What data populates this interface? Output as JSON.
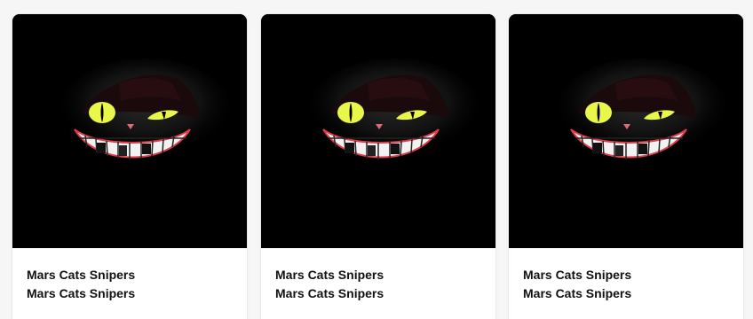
{
  "cards": [
    {
      "collection": "Mars Cats Snipers",
      "name": "Mars Cats Snipers",
      "image": "cheshire-cat-grin-art"
    },
    {
      "collection": "Mars Cats Snipers",
      "name": "Mars Cats Snipers",
      "image": "cheshire-cat-grin-art"
    },
    {
      "collection": "Mars Cats Snipers",
      "name": "Mars Cats Snipers",
      "image": "cheshire-cat-grin-art"
    }
  ],
  "colors": {
    "art_background": "#000000",
    "eye": "#e8f74a",
    "card_background": "#ffffff",
    "page_background": "#f6f6f6"
  }
}
